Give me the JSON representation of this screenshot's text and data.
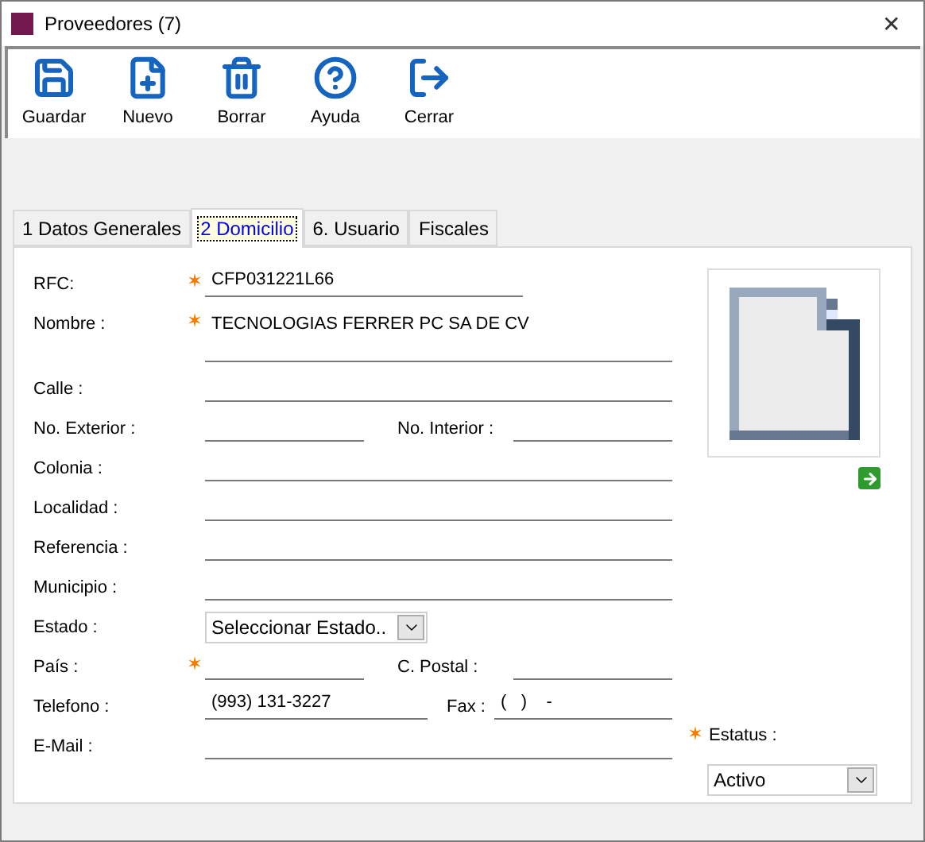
{
  "window": {
    "title": "Proveedores (7)",
    "close": "✕"
  },
  "toolbar": [
    {
      "kind": "save",
      "label": "Guardar"
    },
    {
      "kind": "new",
      "label": "Nuevo"
    },
    {
      "kind": "delete",
      "label": "Borrar"
    },
    {
      "kind": "help",
      "label": "Ayuda"
    },
    {
      "kind": "exit",
      "label": "Cerrar"
    }
  ],
  "tabs": [
    {
      "label": "1 Datos Generales",
      "selected": false
    },
    {
      "label": "2 Domicilio",
      "selected": true
    },
    {
      "label": "6. Usuario",
      "selected": false
    },
    {
      "label": "Fiscales",
      "selected": false
    }
  ],
  "form": [
    {
      "label": "RFC:",
      "required": true,
      "kind": "short",
      "value": "CFP031221L66"
    },
    {
      "label": "Nombre :",
      "required": true,
      "kind": "multiline",
      "value": "TECNOLOGIAS FERRER PC SA DE CV"
    },
    {
      "label": "Calle :",
      "required": false,
      "kind": "line"
    },
    {
      "label": "No. Exterior :",
      "required": false,
      "kind": "pair",
      "second": {
        "label": "No. Interior :"
      }
    },
    {
      "label": "Colonia :",
      "required": false,
      "kind": "line"
    },
    {
      "label": "Localidad :",
      "required": false,
      "kind": "line"
    },
    {
      "label": "Referencia :",
      "required": false,
      "kind": "line"
    },
    {
      "label": "Municipio :",
      "required": false,
      "kind": "line"
    },
    {
      "label": "Estado :",
      "required": false,
      "kind": "select",
      "value": "Seleccionar Estado.."
    },
    {
      "label": "País :",
      "required": true,
      "kind": "pair",
      "second": {
        "label": "C. Postal :"
      }
    },
    {
      "label": "Telefono :",
      "required": false,
      "kind": "pair",
      "value": "(993) 131-3227",
      "second": {
        "label": "Fax :",
        "value": "(   )    -"
      }
    },
    {
      "label": "E-Mail :",
      "required": false,
      "kind": "line"
    }
  ],
  "status": {
    "label": "Estatus :",
    "required": true,
    "value": "Activo"
  }
}
